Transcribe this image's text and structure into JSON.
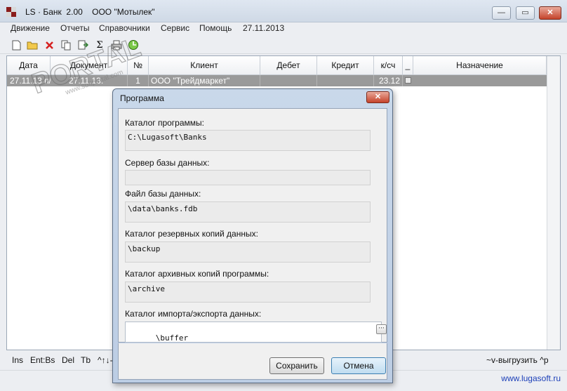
{
  "window": {
    "title": "LS · Банк  2.00    ООО \"Мотылек\"",
    "controls": {
      "minimize": "—",
      "maximize": "▭",
      "close": "✕"
    }
  },
  "menu": {
    "items": [
      "Движение",
      "Отчеты",
      "Справочники",
      "Сервис",
      "Помощь"
    ],
    "date": "27.11.2013"
  },
  "toolbar": {
    "icons": [
      "new-document-icon",
      "open-folder-icon",
      "delete-icon",
      "copy-icon",
      "export-icon",
      "sum-icon",
      "print-icon",
      "refresh-icon"
    ]
  },
  "grid": {
    "columns": [
      "Дата",
      "Документ",
      "№",
      "Клиент",
      "Дебет",
      "Кредит",
      "к/сч",
      "_",
      "Назначение"
    ],
    "row": {
      "date": "27.11.13",
      "doc_type": "п/п",
      "doc_date": "27.11.13.",
      "number": "1",
      "client": "ООО \"Трейдмаркет\"",
      "debit": "",
      "credit": "",
      "account": "23.12",
      "purpose": ""
    }
  },
  "status": {
    "left": [
      "Ins",
      "Ent:Bs",
      "Del",
      "Tb",
      "^↑↓-"
    ],
    "right": "~v-выгрузить  ^р"
  },
  "footer": {
    "link": "www.lugasoft.ru"
  },
  "watermark": {
    "text": "PORTAL",
    "sub": "www.softportal.com"
  },
  "dialog": {
    "title": "Программа",
    "close": "✕",
    "fields": [
      {
        "label": "Каталог программы:",
        "value": "C:\\Lugasoft\\Banks"
      },
      {
        "label": "Сервер базы данных:",
        "value": ""
      },
      {
        "label": "Файл базы данных:",
        "value": "\\data\\banks.fdb"
      },
      {
        "label": "Каталог резервных копий данных:",
        "value": "\\backup"
      },
      {
        "label": "Каталог архивных копий программы:",
        "value": "\\archive"
      },
      {
        "label": "Каталог импорта/экспорта данных:",
        "value": "\\buffer"
      }
    ],
    "browse_button": "···",
    "save_button": "Сохранить",
    "cancel_button": "Отмена"
  }
}
